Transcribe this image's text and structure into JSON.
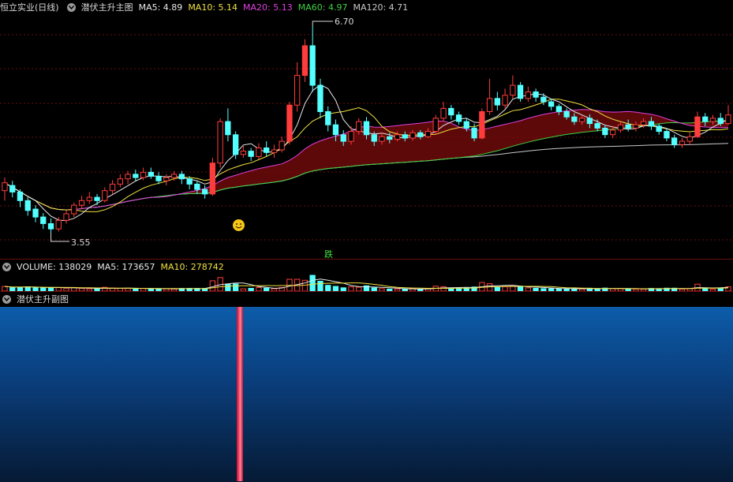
{
  "main": {
    "stock_title": "恒立实业(日线)",
    "indicator_name": "潜伏主升主图",
    "ma": [
      {
        "label": "MA5: 4.89",
        "color": "#e8e8e8"
      },
      {
        "label": "MA10: 5.14",
        "color": "#f0e040"
      },
      {
        "label": "MA20: 5.13",
        "color": "#e040e0"
      },
      {
        "label": "MA60: 4.97",
        "color": "#40d040"
      },
      {
        "label": "MA120: 4.71",
        "color": "#c8c8c8"
      }
    ],
    "high_label": "6.70",
    "low_label": "3.55",
    "signal_text": "跌",
    "smiley_icon": "smiley-face-icon"
  },
  "volume": {
    "label": "VOLUME: 138029",
    "ma5": "MA5: 173657",
    "ma10": "MA10: 278742"
  },
  "sub": {
    "title": "潜伏主升副图"
  },
  "colors": {
    "up": "#ff3c3c",
    "down": "#54ffff",
    "bg": "#000000",
    "grid": "#6a0e0e",
    "sub_blue": "#0a5aa8"
  },
  "chart_data": {
    "type": "candlestick",
    "high": 6.7,
    "low": 3.55,
    "candles": [
      [
        4.2,
        4.32,
        4.4,
        4.05
      ],
      [
        4.28,
        4.18,
        4.35,
        4.1
      ],
      [
        4.18,
        4.05,
        4.22,
        3.95
      ],
      [
        4.05,
        3.9,
        4.1,
        3.82
      ],
      [
        3.92,
        3.8,
        3.98,
        3.72
      ],
      [
        3.8,
        3.7,
        3.86,
        3.62
      ],
      [
        3.7,
        3.62,
        3.78,
        3.55
      ],
      [
        3.62,
        3.75,
        3.8,
        3.58
      ],
      [
        3.75,
        3.85,
        3.9,
        3.7
      ],
      [
        3.85,
        3.98,
        4.02,
        3.8
      ],
      [
        3.98,
        4.05,
        4.12,
        3.92
      ],
      [
        4.05,
        4.1,
        4.18,
        4.0
      ],
      [
        4.1,
        4.05,
        4.15,
        3.98
      ],
      [
        4.05,
        4.2,
        4.25,
        4.02
      ],
      [
        4.2,
        4.3,
        4.36,
        4.15
      ],
      [
        4.3,
        4.38,
        4.45,
        4.25
      ],
      [
        4.38,
        4.45,
        4.5,
        4.3
      ],
      [
        4.45,
        4.4,
        4.52,
        4.35
      ],
      [
        4.4,
        4.48,
        4.55,
        4.36
      ],
      [
        4.48,
        4.42,
        4.55,
        4.38
      ],
      [
        4.42,
        4.35,
        4.48,
        4.3
      ],
      [
        4.35,
        4.4,
        4.45,
        4.28
      ],
      [
        4.4,
        4.45,
        4.5,
        4.35
      ],
      [
        4.45,
        4.38,
        4.5,
        4.3
      ],
      [
        4.38,
        4.3,
        4.42,
        4.22
      ],
      [
        4.3,
        4.22,
        4.35,
        4.15
      ],
      [
        4.22,
        4.15,
        4.28,
        4.08
      ],
      [
        4.15,
        4.62,
        4.7,
        4.12
      ],
      [
        4.62,
        5.25,
        5.3,
        4.55
      ],
      [
        5.25,
        5.05,
        5.45,
        4.95
      ],
      [
        5.05,
        4.75,
        5.1,
        4.68
      ],
      [
        4.75,
        4.8,
        4.88,
        4.7
      ],
      [
        4.8,
        4.72,
        4.85,
        4.65
      ],
      [
        4.72,
        4.85,
        4.92,
        4.68
      ],
      [
        4.85,
        4.78,
        4.95,
        4.72
      ],
      [
        4.78,
        4.82,
        4.9,
        4.7
      ],
      [
        4.82,
        4.95,
        5.02,
        4.78
      ],
      [
        4.95,
        5.5,
        5.55,
        4.9
      ],
      [
        5.5,
        5.95,
        6.15,
        5.4
      ],
      [
        5.95,
        6.4,
        6.5,
        5.85
      ],
      [
        6.4,
        5.8,
        6.7,
        5.7
      ],
      [
        5.8,
        5.4,
        5.9,
        5.3
      ],
      [
        5.4,
        5.2,
        5.48,
        5.1
      ],
      [
        5.2,
        5.05,
        5.28,
        4.95
      ],
      [
        5.05,
        4.95,
        5.12,
        4.88
      ],
      [
        4.95,
        5.1,
        5.18,
        4.9
      ],
      [
        5.1,
        5.25,
        5.3,
        5.05
      ],
      [
        5.25,
        5.05,
        5.32,
        4.98
      ],
      [
        5.05,
        4.95,
        5.1,
        4.88
      ],
      [
        4.95,
        5.02,
        5.08,
        4.9
      ],
      [
        5.02,
        4.98,
        5.08,
        4.92
      ],
      [
        4.98,
        5.05,
        5.1,
        4.95
      ],
      [
        5.05,
        5.0,
        5.1,
        4.95
      ],
      [
        5.0,
        5.08,
        5.12,
        4.96
      ],
      [
        5.08,
        5.02,
        5.12,
        4.98
      ],
      [
        5.02,
        5.1,
        5.15,
        5.0
      ],
      [
        5.1,
        5.3,
        5.35,
        5.05
      ],
      [
        5.3,
        5.45,
        5.55,
        5.25
      ],
      [
        5.45,
        5.35,
        5.5,
        5.28
      ],
      [
        5.35,
        5.25,
        5.4,
        5.2
      ],
      [
        5.25,
        5.15,
        5.3,
        5.1
      ],
      [
        5.15,
        5.0,
        5.22,
        4.95
      ],
      [
        5.0,
        5.4,
        5.45,
        4.98
      ],
      [
        5.4,
        5.6,
        5.9,
        5.35
      ],
      [
        5.6,
        5.5,
        5.7,
        5.42
      ],
      [
        5.5,
        5.65,
        5.75,
        5.45
      ],
      [
        5.65,
        5.8,
        5.95,
        5.6
      ],
      [
        5.8,
        5.6,
        5.85,
        5.55
      ],
      [
        5.6,
        5.7,
        5.78,
        5.55
      ],
      [
        5.7,
        5.62,
        5.75,
        5.55
      ],
      [
        5.62,
        5.55,
        5.68,
        5.5
      ],
      [
        5.55,
        5.48,
        5.6,
        5.42
      ],
      [
        5.48,
        5.4,
        5.52,
        5.35
      ],
      [
        5.4,
        5.32,
        5.45,
        5.28
      ],
      [
        5.32,
        5.25,
        5.38,
        5.2
      ],
      [
        5.25,
        5.3,
        5.35,
        5.2
      ],
      [
        5.3,
        5.22,
        5.36,
        5.15
      ],
      [
        5.22,
        5.15,
        5.28,
        5.1
      ],
      [
        5.15,
        5.05,
        5.2,
        5.0
      ],
      [
        5.05,
        5.12,
        5.18,
        5.0
      ],
      [
        5.12,
        5.2,
        5.25,
        5.08
      ],
      [
        5.2,
        5.15,
        5.28,
        5.1
      ],
      [
        5.15,
        5.2,
        5.25,
        5.1
      ],
      [
        5.2,
        5.25,
        5.3,
        5.15
      ],
      [
        5.25,
        5.18,
        5.32,
        5.12
      ],
      [
        5.18,
        5.1,
        5.22,
        5.05
      ],
      [
        5.1,
        5.0,
        5.15,
        4.95
      ],
      [
        5.0,
        4.9,
        5.05,
        4.85
      ],
      [
        4.9,
        4.95,
        5.0,
        4.85
      ],
      [
        4.95,
        5.02,
        5.08,
        4.9
      ],
      [
        5.02,
        5.32,
        5.4,
        5.0
      ],
      [
        5.32,
        5.25,
        5.38,
        5.18
      ],
      [
        5.25,
        5.3,
        5.35,
        5.2
      ],
      [
        5.3,
        5.22,
        5.38,
        5.18
      ],
      [
        5.22,
        5.35,
        5.5,
        5.2
      ]
    ]
  }
}
